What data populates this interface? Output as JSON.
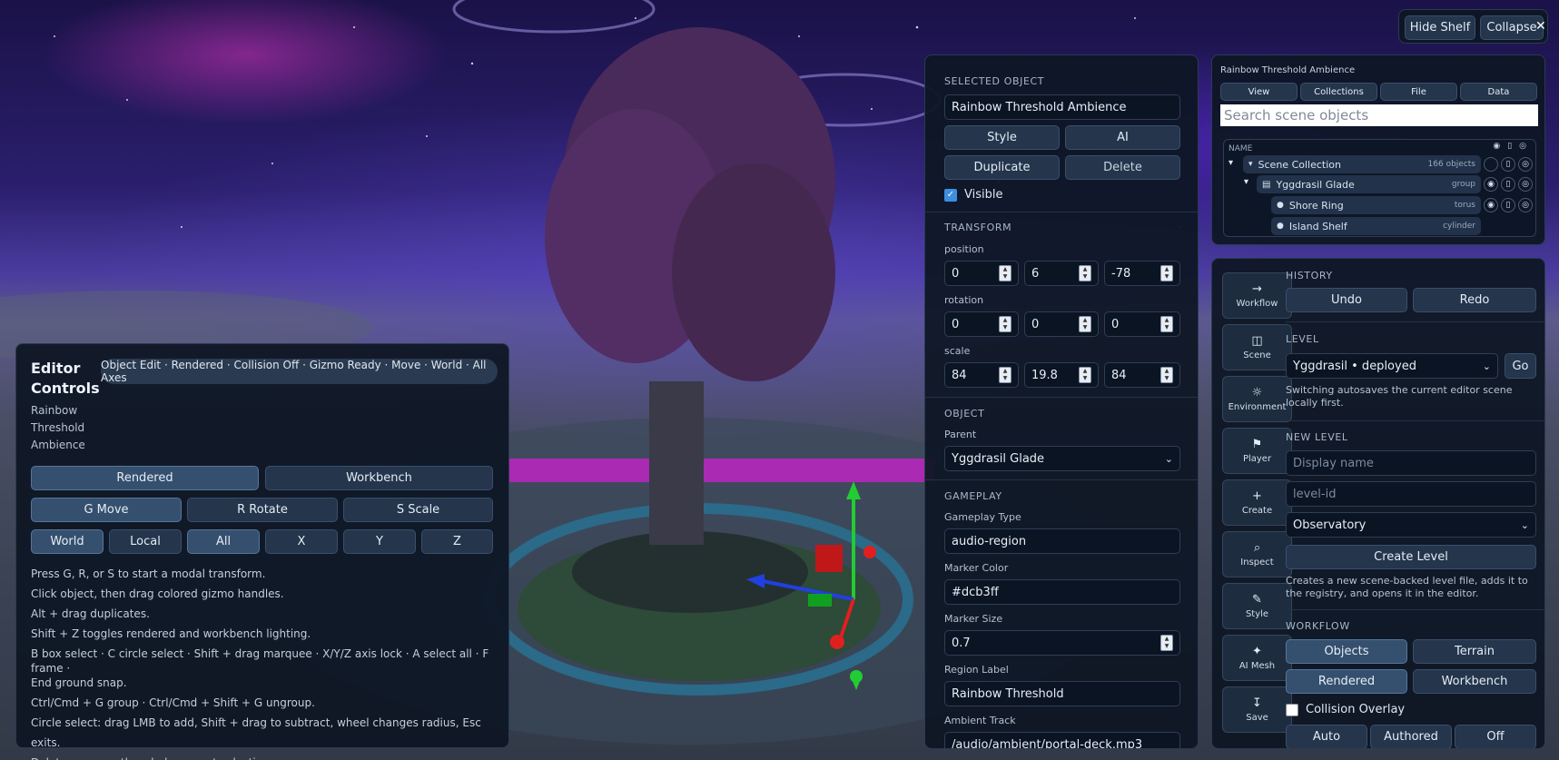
{
  "top": {
    "hide_shelf": "Hide Shelf",
    "collapse": "Collapse"
  },
  "editor": {
    "title_line1": "Editor",
    "title_line2": "Controls",
    "status": "Object Edit · Rendered · Collision Off · Gizmo Ready · Move · World · All Axes",
    "object_line1": "Rainbow",
    "object_line2": "Threshold",
    "object_line3": "Ambience",
    "shading": [
      "Rendered",
      "Workbench"
    ],
    "tools": [
      "G Move",
      "R Rotate",
      "S Scale"
    ],
    "space": [
      "World",
      "Local",
      "All",
      "X",
      "Y",
      "Z"
    ],
    "help": [
      "Press G, R, or S to start a modal transform.",
      "Click object, then drag colored gizmo handles.",
      "Alt + drag duplicates.",
      "Shift + Z toggles rendered and workbench lighting.",
      "B box select · C circle select · Shift + drag marquee · X/Y/Z axis lock · A select all · F frame ·",
      "End ground snap.",
      "Ctrl/Cmd + G group · Ctrl/Cmd + Shift + G ungroup.",
      "Circle select: drag LMB to add, Shift + drag to subtract, wheel changes radius, Esc exits.",
      "Delete removes the whole current selection."
    ]
  },
  "inspector": {
    "selected_title": "SELECTED OBJECT",
    "name_value": "Rainbow Threshold Ambience",
    "style": "Style",
    "ai": "AI",
    "duplicate": "Duplicate",
    "delete": "Delete",
    "visible": "Visible",
    "transform_title": "TRANSFORM",
    "position_label": "position",
    "position": [
      "0",
      "6",
      "-78"
    ],
    "rotation_label": "rotation",
    "rotation": [
      "0",
      "0",
      "0"
    ],
    "scale_label": "scale",
    "scale": [
      "84",
      "19.8",
      "84"
    ],
    "object_title": "OBJECT",
    "parent_label": "Parent",
    "parent_value": "Yggdrasil Glade",
    "gameplay_title": "GAMEPLAY",
    "gameplay_type_label": "Gameplay Type",
    "gameplay_type_value": "audio-region",
    "marker_color_label": "Marker Color",
    "marker_color_value": "#dcb3ff",
    "marker_size_label": "Marker Size",
    "marker_size_value": "0.7",
    "region_label_label": "Region Label",
    "region_label_value": "Rainbow Threshold",
    "ambient_track_label": "Ambient Track",
    "ambient_track_value": "/audio/ambient/portal-deck.mp3"
  },
  "outliner": {
    "header": "Rainbow Threshold Ambience",
    "tabs": [
      "View",
      "Collections",
      "File",
      "Data"
    ],
    "search_placeholder": "Search scene objects",
    "name_col": "NAME",
    "rows": [
      {
        "name": "Scene Collection",
        "meta": "166 objects"
      },
      {
        "name": "Yggdrasil Glade",
        "meta": "group"
      },
      {
        "name": "Shore Ring",
        "meta": "torus"
      },
      {
        "name": "Island Shelf",
        "meta": "cylinder"
      }
    ]
  },
  "sidebar": {
    "items": [
      {
        "icon": "→",
        "label": "Workflow"
      },
      {
        "icon": "◫",
        "label": "Scene"
      },
      {
        "icon": "☼",
        "label": "Environment"
      },
      {
        "icon": "⚑",
        "label": "Player"
      },
      {
        "icon": "+",
        "label": "Create"
      },
      {
        "icon": "⌕",
        "label": "Inspect"
      },
      {
        "icon": "✎",
        "label": "Style"
      },
      {
        "icon": "✦",
        "label": "AI Mesh"
      },
      {
        "icon": "↧",
        "label": "Save"
      }
    ]
  },
  "workflow": {
    "history_title": "HISTORY",
    "undo": "Undo",
    "redo": "Redo",
    "level_title": "LEVEL",
    "level_value": "Yggdrasil • deployed",
    "go": "Go",
    "level_note": "Switching autosaves the current editor scene locally first.",
    "new_level_title": "NEW LEVEL",
    "display_name_placeholder": "Display name",
    "level_id_placeholder": "level-id",
    "template_value": "Observatory",
    "create_level": "Create Level",
    "create_note": "Creates a new scene-backed level file, adds it to the registry, and opens it in the editor.",
    "workflow_title": "WORKFLOW",
    "objects": "Objects",
    "terrain": "Terrain",
    "rendered": "Rendered",
    "workbench": "Workbench",
    "collision_overlay": "Collision Overlay",
    "auto": "Auto",
    "authored": "Authored",
    "off": "Off"
  },
  "colors": {
    "gizmo_x": "#e02020",
    "gizmo_y": "#22cc33",
    "gizmo_z": "#2040e0",
    "tree": "#4a2a5a",
    "ground_ring": "#2b6a88"
  }
}
